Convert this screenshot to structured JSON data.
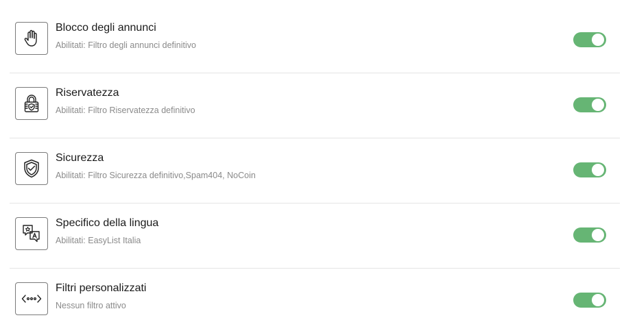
{
  "filters": [
    {
      "icon": "hand-stop-icon",
      "title": "Blocco degli annunci",
      "subtitle": "Abilitati: Filtro degli annunci definitivo",
      "enabled": true
    },
    {
      "icon": "lock-shield-icon",
      "title": "Riservatezza",
      "subtitle": "Abilitati: Filtro Riservatezza definitivo",
      "enabled": true
    },
    {
      "icon": "shield-check-icon",
      "title": "Sicurezza",
      "subtitle": "Abilitati: Filtro Sicurezza definitivo,Spam404, NoCoin",
      "enabled": true
    },
    {
      "icon": "language-translate-icon",
      "title": "Specifico della lingua",
      "subtitle": "Abilitati: EasyList Italia",
      "enabled": true
    },
    {
      "icon": "code-brackets-icon",
      "title": "Filtri personalizzati",
      "subtitle": "Nessun filtro attivo",
      "enabled": true
    }
  ],
  "colors": {
    "toggle_on": "#66b574",
    "subtitle_text": "#8a8a8a",
    "divider": "#e4e4e4"
  }
}
